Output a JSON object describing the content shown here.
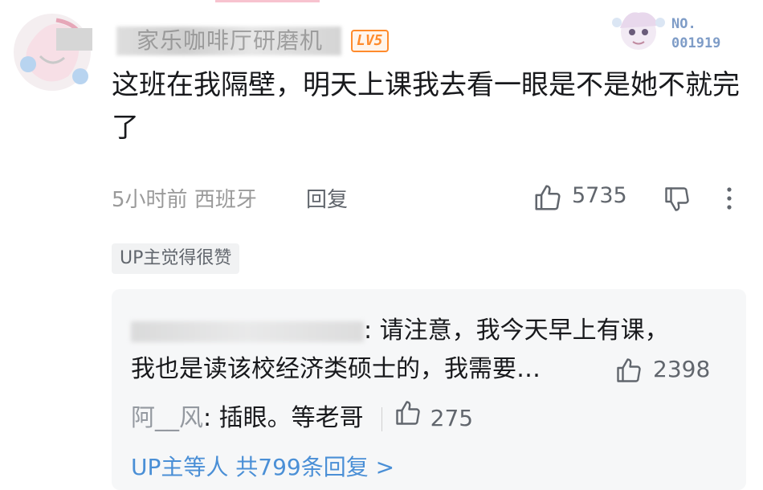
{
  "comment": {
    "username": "家乐咖啡厅研磨机",
    "level": "LV5",
    "fan_badge": {
      "no_label": "NO.",
      "number": "001919"
    },
    "content": "这班在我隔壁，明天上课我去看一眼是不是她不就完了",
    "time": "5小时前",
    "location": "西班牙",
    "reply_label": "回复",
    "likes": "5735",
    "up_badge": "UP主觉得很赞"
  },
  "replies": [
    {
      "text": ": 请注意，我今天早上有课，",
      "text_line2": "我也是读该校经济类硕士的，我需要…",
      "likes": "2398"
    },
    {
      "name": "阿__风",
      "text": ": 插眼。等老哥",
      "likes": "275"
    }
  ],
  "more_replies": "UP主等人 共799条回复 >",
  "colors": {
    "level": "#ff8b2c",
    "link": "#4a8fd6",
    "muted": "#9a9a9a",
    "reply_bg": "#f6f7f8"
  }
}
